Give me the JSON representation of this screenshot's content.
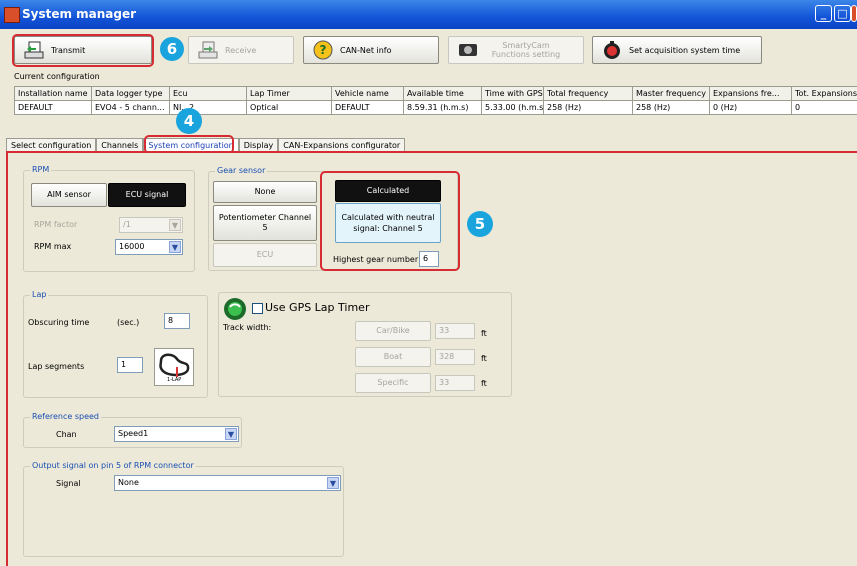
{
  "window": {
    "title": "System manager",
    "minimize": "_",
    "maximize": "□",
    "close": "X"
  },
  "toolbar": {
    "transmit": "Transmit",
    "receive": "Receive",
    "cannet": "CAN-Net info",
    "smartycam": "SmartyCam Functions setting",
    "acq_time": "Set acquisition system time"
  },
  "badges": {
    "transmit": "6",
    "tab": "4",
    "gear": "5"
  },
  "config": {
    "label": "Current configuration",
    "headers": [
      "Installation name",
      "Data logger type",
      "Ecu",
      "Lap Timer",
      "Vehicle name",
      "Available time",
      "Time with GPS",
      "Total frequency",
      "Master frequency",
      "Expansions fre...",
      "Tot. Expansions"
    ],
    "row": [
      "DEFAULT",
      "EVO4 - 5 chann...",
      "NI...2",
      "Optical",
      "DEFAULT",
      "8.59.31 (h.m.s)",
      "5.33.00 (h.m.s)",
      "258 (Hz)",
      "258 (Hz)",
      "0 (Hz)",
      "0"
    ]
  },
  "tabs": [
    "Select configuration",
    "Channels",
    "System configuration",
    "Display",
    "CAN-Expansions configurator"
  ],
  "rpm": {
    "title": "RPM",
    "aim": "AIM sensor",
    "ecu": "ECU signal",
    "factor_label": "RPM factor",
    "factor_value": "/1",
    "max_label": "RPM max",
    "max_value": "16000"
  },
  "gear": {
    "title": "Gear sensor",
    "none": "None",
    "potentiometer": "Potentiometer Channel 5",
    "ecu": "ECU",
    "calculated": "Calculated",
    "calc_neutral": "Calculated with neutral signal: Channel 5",
    "highest_label": "Highest gear number",
    "highest_value": "6"
  },
  "lap": {
    "title": "Lap",
    "obscuring_label": "Obscuring time",
    "obscuring_unit": "(sec.)",
    "obscuring_value": "8",
    "segments_label": "Lap segments",
    "segments_value": "1",
    "icon_caption": "1-LAP"
  },
  "gps": {
    "use_label": "Use GPS Lap Timer",
    "track_width": "Track width:",
    "carbike": "Car/Bike",
    "carbike_value": "33",
    "boat": "Boat",
    "boat_value": "328",
    "specific": "Specific",
    "specific_value": "33",
    "unit": "ft"
  },
  "refspeed": {
    "title": "Reference speed",
    "chan_label": "Chan",
    "chan_value": "Speed1"
  },
  "output": {
    "title": "Output signal on pin 5 of RPM connector",
    "signal_label": "Signal",
    "signal_value": "None"
  },
  "colors": {
    "accent": "#1aa4de",
    "highlight": "#d62b32",
    "titlebar": "#1353d8"
  }
}
